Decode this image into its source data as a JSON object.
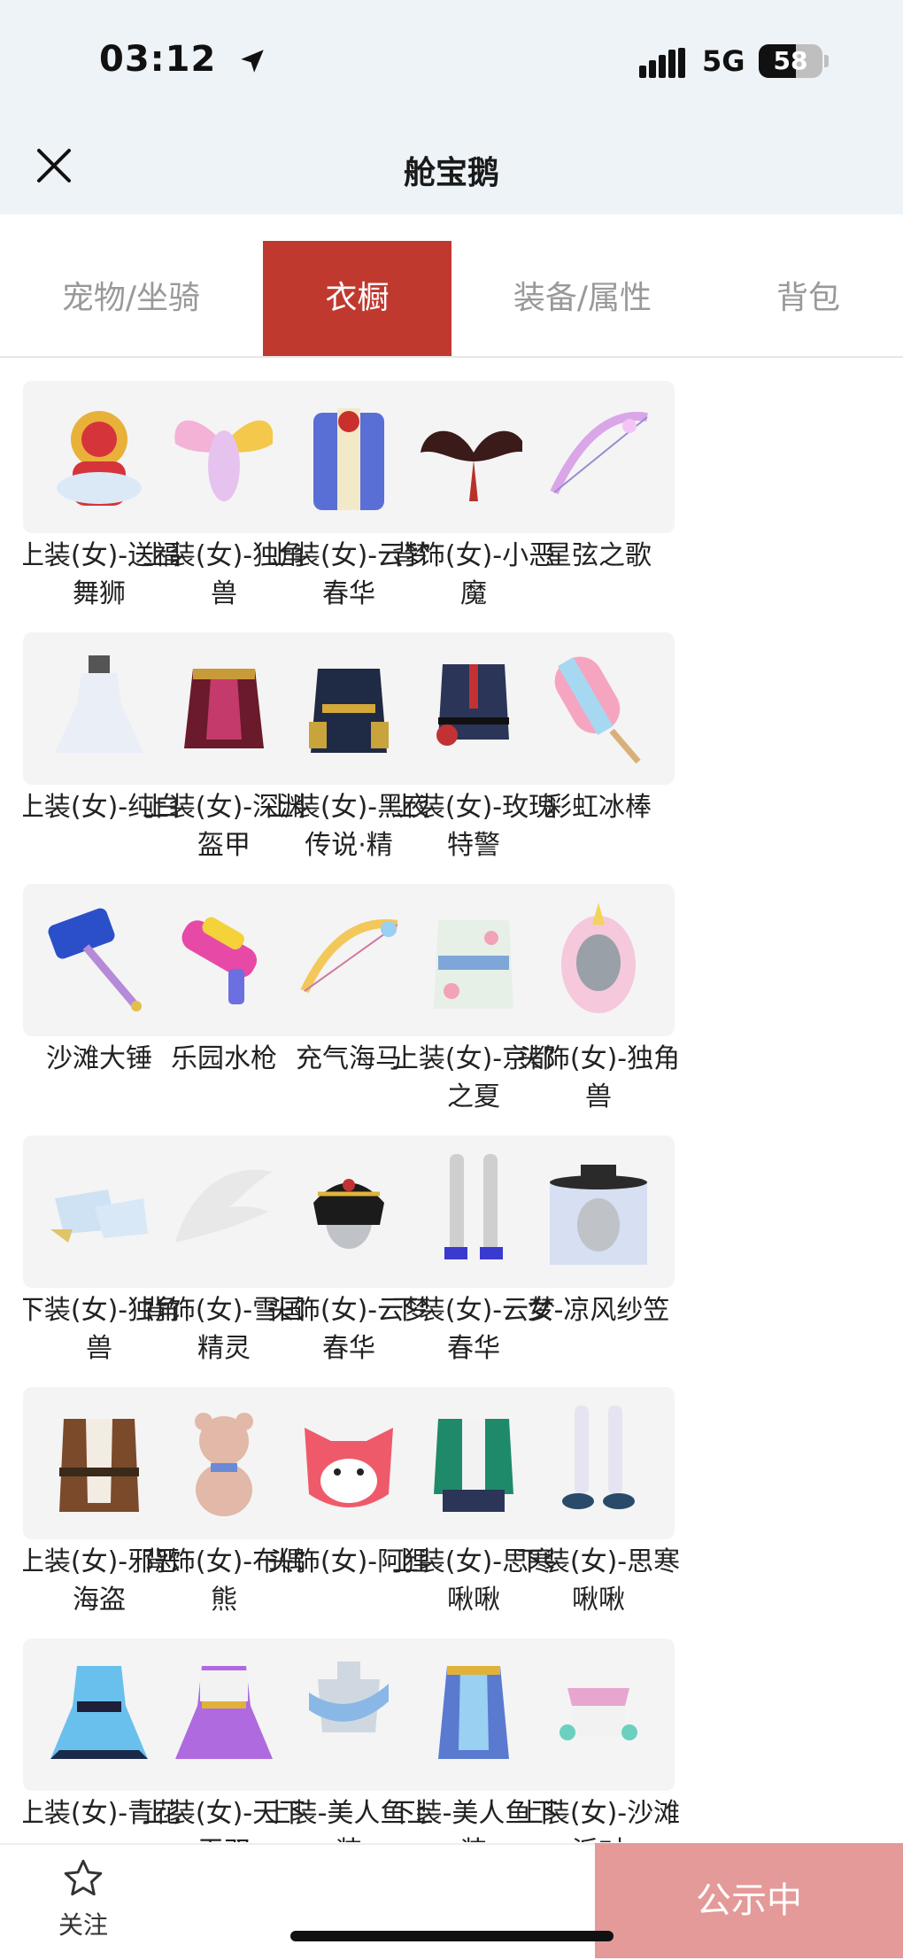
{
  "status": {
    "time": "03:12",
    "network": "5G",
    "battery": "58",
    "battery_level": 0.58
  },
  "header": {
    "title": "舱宝鹅"
  },
  "tabs": [
    {
      "label": "宠物/坐骑",
      "active": false
    },
    {
      "label": "衣橱",
      "active": true
    },
    {
      "label": "装备/属性",
      "active": false
    },
    {
      "label": "背包",
      "active": false
    }
  ],
  "items": [
    {
      "name": "上装(女)-送福舞狮",
      "icon": "lion-costume-icon"
    },
    {
      "name": "上装(女)-独角兽",
      "icon": "rainbow-wings-bodysuit-icon"
    },
    {
      "name": "上装(女)-云梦春华",
      "icon": "blue-robe-icon"
    },
    {
      "name": "背饰(女)-小恶魔",
      "icon": "devil-wings-icon"
    },
    {
      "name": "星弦之歌",
      "icon": "star-bow-icon"
    },
    {
      "name": "上装(女)-纯白",
      "icon": "white-dress-icon"
    },
    {
      "name": "上装(女)-深渊盔甲",
      "icon": "abyss-armor-icon"
    },
    {
      "name": "上装(女)-黑夜传说·精",
      "icon": "dark-uniform-icon"
    },
    {
      "name": "上装(女)-玫瑰特警",
      "icon": "rose-police-jacket-icon"
    },
    {
      "name": "彩虹冰棒",
      "icon": "rainbow-popsicle-icon"
    },
    {
      "name": "沙滩大锤",
      "icon": "beach-hammer-icon"
    },
    {
      "name": "乐园水枪",
      "icon": "water-gun-icon"
    },
    {
      "name": "充气海马",
      "icon": "inflatable-seahorse-bow-icon"
    },
    {
      "name": "上装(女)-京都之夏",
      "icon": "kimono-icon"
    },
    {
      "name": "头饰(女)-独角兽",
      "icon": "unicorn-hood-icon"
    },
    {
      "name": "下装(女)-独角兽",
      "icon": "unicorn-boots-icon"
    },
    {
      "name": "背饰(女)-雪国精灵",
      "icon": "snow-wing-icon"
    },
    {
      "name": "头饰(女)-云梦春华",
      "icon": "ornate-headdress-icon"
    },
    {
      "name": "下装(女)-云梦春华",
      "icon": "heeled-legs-icon"
    },
    {
      "name": "女-凉风纱笠",
      "icon": "veil-hat-icon"
    },
    {
      "name": "上装(女)-邪恶海盗",
      "icon": "pirate-coat-icon"
    },
    {
      "name": "背饰(女)-布偶熊",
      "icon": "teddy-bear-icon"
    },
    {
      "name": "头饰(女)-阿狸",
      "icon": "fox-head-icon"
    },
    {
      "name": "上装(女)-思寒啾啾",
      "icon": "green-cardigan-icon"
    },
    {
      "name": "下装(女)-思寒啾啾",
      "icon": "sneaker-legs-icon"
    },
    {
      "name": "上装(女)-青花",
      "icon": "blue-white-dress-icon"
    },
    {
      "name": "上装(女)-天下无双",
      "icon": "purple-dress-icon"
    },
    {
      "name": "上装-美人鱼上装",
      "icon": "mermaid-top-icon"
    },
    {
      "name": "下装-美人鱼下装",
      "icon": "mermaid-skirt-icon"
    },
    {
      "name": "上装(女)-沙滩派对",
      "icon": "beach-top-icon"
    }
  ],
  "footer": {
    "follow_label": "关注",
    "status_button": "公示中"
  },
  "colors": {
    "accent": "#c0392f",
    "button_faded": "#e39a98",
    "tab_inactive": "#999999"
  }
}
